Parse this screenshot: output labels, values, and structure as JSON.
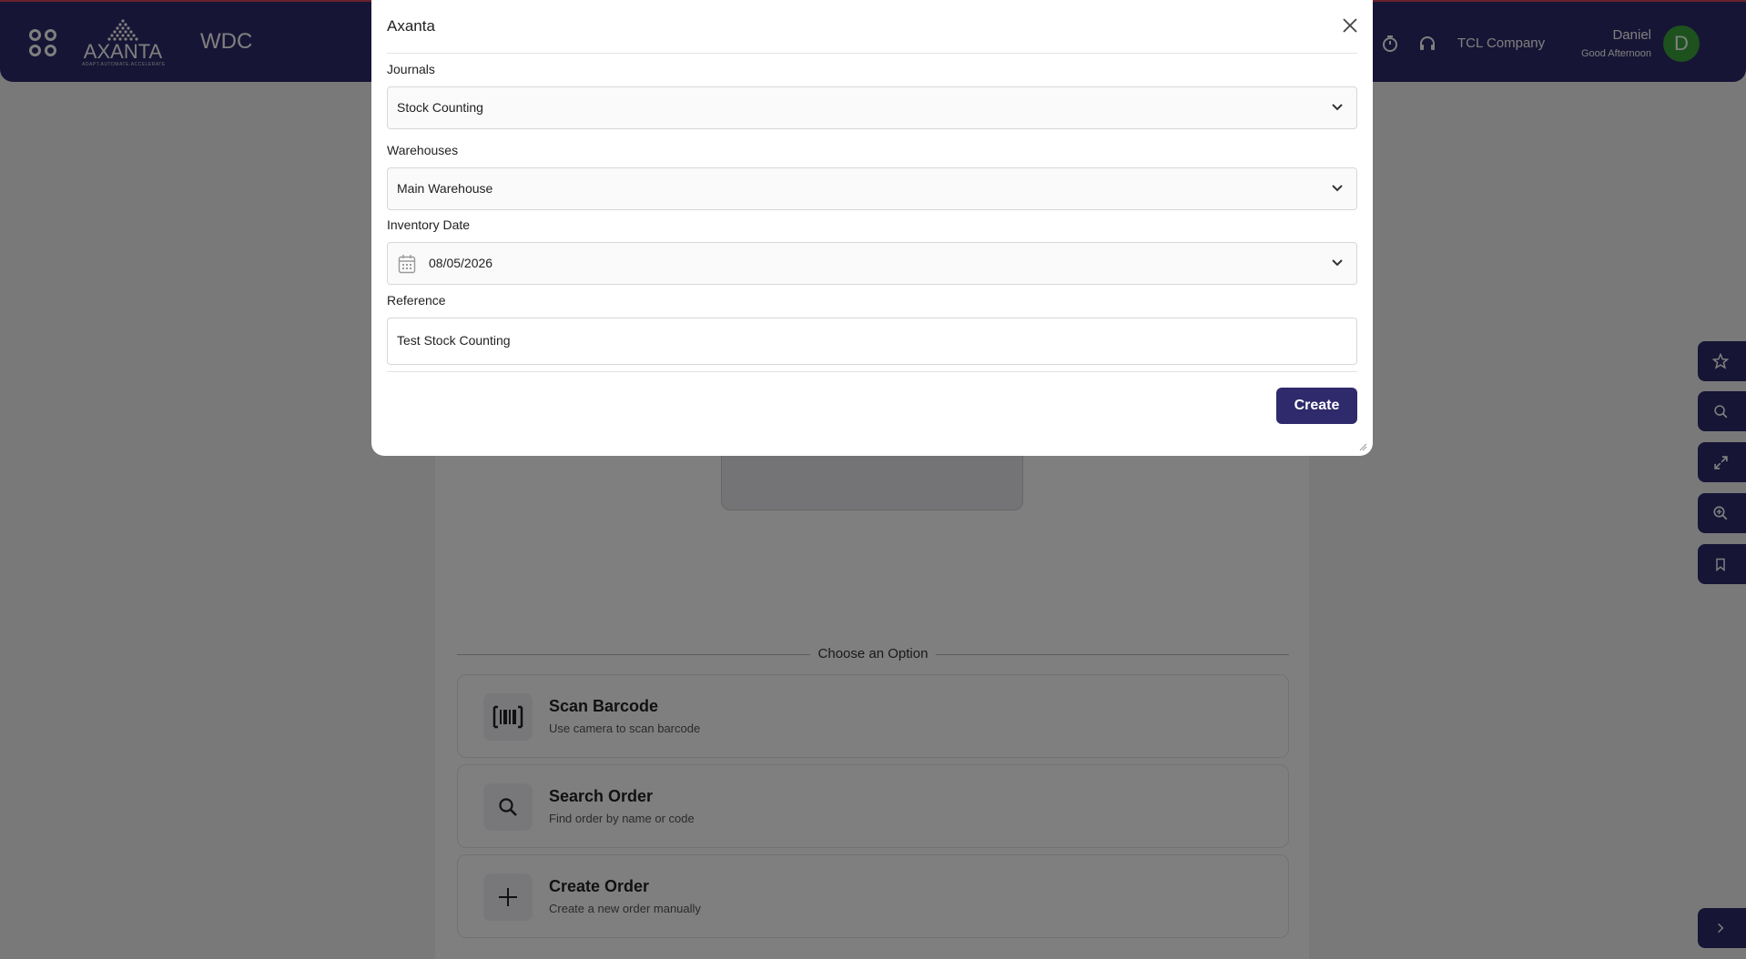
{
  "header": {
    "logo_text": "AXANTA",
    "logo_tagline": "ADAPT.AUTOMATE.ACCELERATE",
    "app_name": "WDC",
    "company": "TCL Company",
    "user_name": "Daniel",
    "greeting": "Good Afternoon",
    "avatar_initial": "D",
    "colors": {
      "primary": "#2f2a6b",
      "avatar": "#3aa33a"
    }
  },
  "main": {
    "divider_text": "Choose an Option",
    "options": [
      {
        "title": "Scan Barcode",
        "description": "Use camera to scan barcode",
        "icon": "barcode-icon"
      },
      {
        "title": "Search Order",
        "description": "Find order by name or code",
        "icon": "search-icon"
      },
      {
        "title": "Create Order",
        "description": "Create a new order manually",
        "icon": "plus-icon"
      }
    ]
  },
  "sidebar_tools": [
    "star-icon",
    "search-icon",
    "expand-icon",
    "zoom-in-icon",
    "bookmark-icon",
    "chevron-right-icon"
  ],
  "modal": {
    "title": "Axanta",
    "journals_label": "Journals",
    "journals_value": "Stock Counting",
    "warehouses_label": "Warehouses",
    "warehouses_value": "Main Warehouse",
    "inventory_date_label": "Inventory Date",
    "inventory_date_value": "08/05/2026",
    "reference_label": "Reference",
    "reference_value": "Test Stock Counting",
    "create_label": "Create"
  }
}
